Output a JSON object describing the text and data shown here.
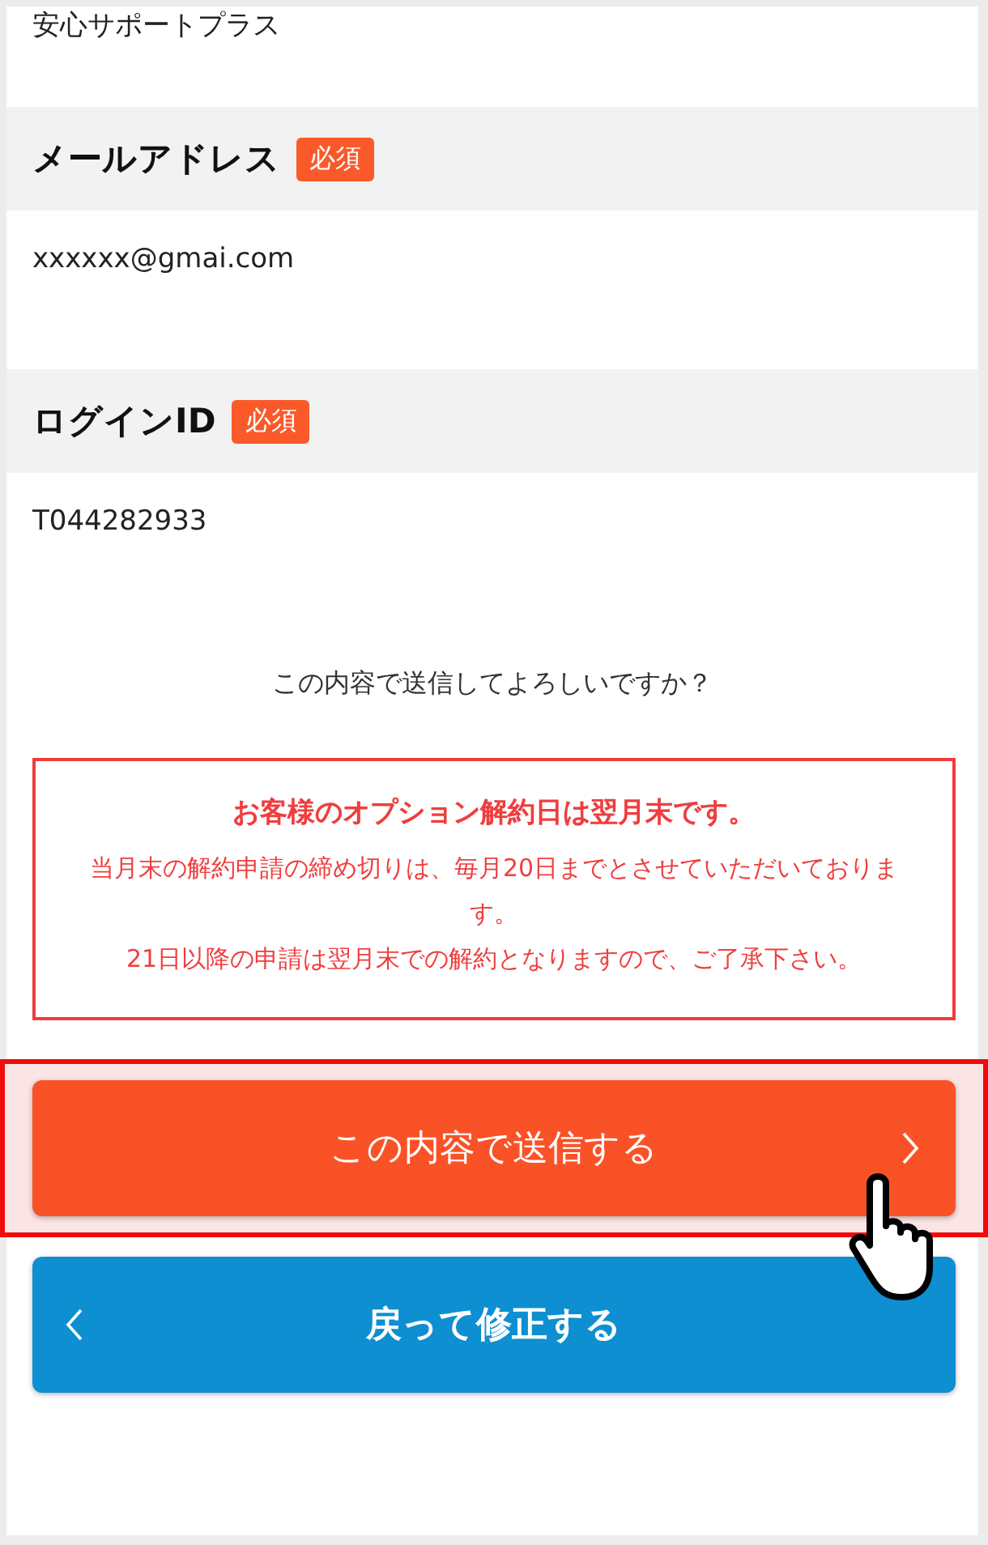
{
  "previous_value": "安心サポートプラス",
  "fields": [
    {
      "label": "メールアドレス",
      "badge": "必須",
      "value": "xxxxxx@gmai.com"
    },
    {
      "label": "ログインID",
      "badge": "必須",
      "value": "T044282933"
    }
  ],
  "confirm_question": "この内容で送信してよろしいですか？",
  "notice": {
    "title": "お客様のオプション解約日は翌月末です。",
    "lines": [
      "当月末の解約申請の締め切りは、毎月20日までとさせていただいております。",
      "21日以降の申請は翌月末での解約となりますので、ご了承下さい。"
    ]
  },
  "buttons": [
    {
      "kind": "submit",
      "label": "この内容で送信する",
      "highlighted": true
    },
    {
      "kind": "back",
      "label": "戻って修正する",
      "highlighted": false
    }
  ]
}
